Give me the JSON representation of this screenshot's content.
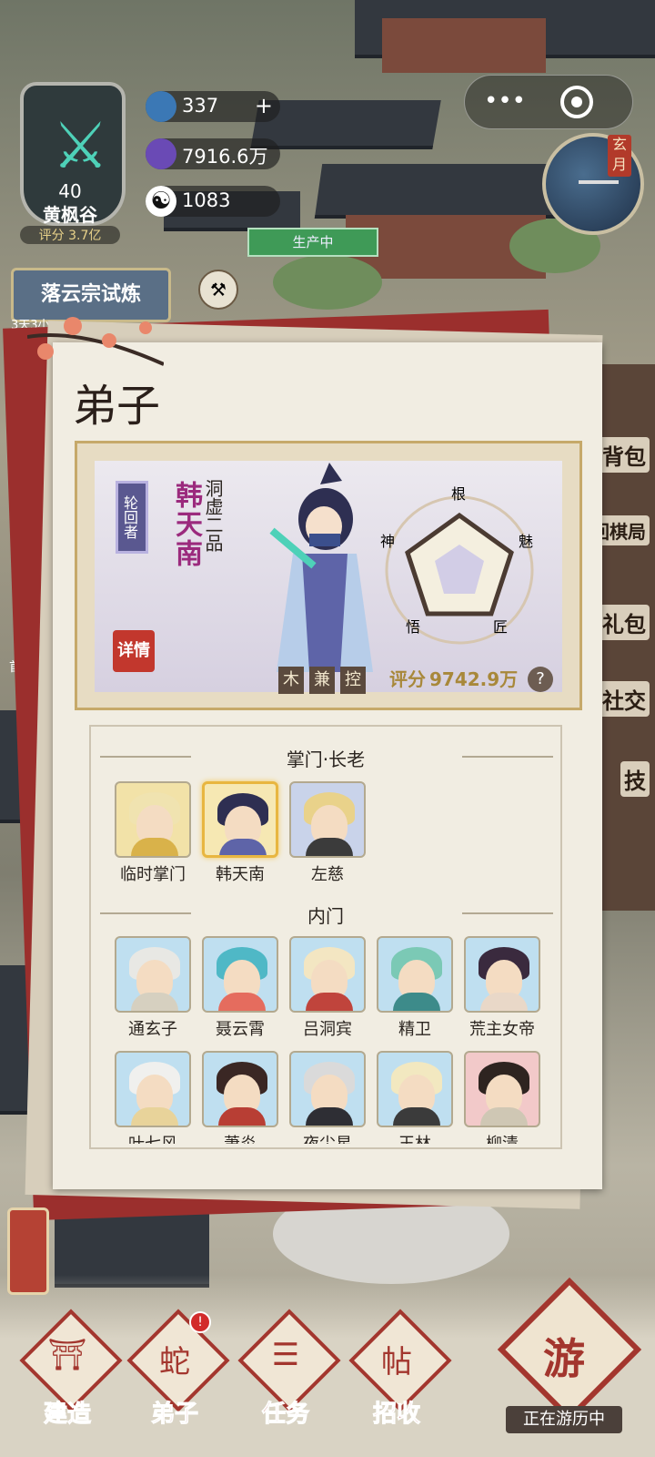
{
  "sect": {
    "level": "40",
    "name": "黄枫谷",
    "score": "评分 3.7亿",
    "emblem_icon": "sword-emblem-icon"
  },
  "resources": [
    {
      "icon": "spirit-stone-icon",
      "value": "337",
      "has_plus": true,
      "color": "#3b78b5"
    },
    {
      "icon": "crystal-icon",
      "value": "7916.6万",
      "has_plus": false,
      "color": "#6a4ab5"
    },
    {
      "icon": "yinyang-icon",
      "value": "1083",
      "has_plus": false,
      "color": "#1a1a1a"
    }
  ],
  "producing_label": "生产中",
  "capsule": {
    "more": "•••"
  },
  "clock_label": "玄月",
  "event": {
    "title": "落云宗试炼",
    "time": "3天3小",
    "tool_icon": "hammer-icon"
  },
  "side_menu": [
    "背包",
    "回棋局",
    "礼包",
    "社交",
    "技"
  ],
  "left_edge_text": "首次",
  "panel": {
    "title": "弟子",
    "hero": {
      "tag": "轮回者",
      "name": "韩天南",
      "rank": "洞虚二品",
      "detail_label": "详情",
      "elements": [
        "木",
        "兼",
        "控"
      ],
      "score_label": "评分",
      "score": "9742.9万",
      "help": "?",
      "radar": {
        "labels": [
          "根",
          "魅",
          "匠",
          "悟",
          "神"
        ]
      }
    },
    "sections": [
      {
        "title": "掌门·长老",
        "members": [
          {
            "name": "临时掌门",
            "bg": "#f2e2a8",
            "hair": "#f0e3b0",
            "body": "#d9b24a",
            "selected": false
          },
          {
            "name": "韩天南",
            "bg": "#f6e8b3",
            "hair": "#2e2f52",
            "body": "#5e64a8",
            "selected": true
          },
          {
            "name": "左慈",
            "bg": "#c9d3ea",
            "hair": "#e9d28a",
            "body": "#3b3b3b",
            "selected": false
          }
        ]
      },
      {
        "title": "内门",
        "members": [
          {
            "name": "通玄子",
            "bg": "#bfdff0",
            "hair": "#e8e8e4",
            "body": "#d6d0c0",
            "selected": false
          },
          {
            "name": "聂云霄",
            "bg": "#bfdff0",
            "hair": "#4fb8c6",
            "body": "#e56c5e",
            "selected": false
          },
          {
            "name": "吕洞宾",
            "bg": "#bfdff0",
            "hair": "#f3e6c2",
            "body": "#c0443c",
            "selected": false
          },
          {
            "name": "精卫",
            "bg": "#bfdff0",
            "hair": "#7bc9b5",
            "body": "#3d8b8a",
            "selected": false
          },
          {
            "name": "荒主女帝",
            "bg": "#bfdff0",
            "hair": "#3a2a3e",
            "body": "#e9d8c8",
            "selected": false
          },
          {
            "name": "叶七风",
            "bg": "#bfdff0",
            "hair": "#f0f0ee",
            "body": "#e8d39a",
            "selected": false
          },
          {
            "name": "萧炎",
            "bg": "#bfdff0",
            "hair": "#3a2724",
            "body": "#b83e34",
            "selected": false
          },
          {
            "name": "夜尘星",
            "bg": "#bfdff0",
            "hair": "#dadada",
            "body": "#2e2e34",
            "selected": false
          },
          {
            "name": "王林",
            "bg": "#bfdff0",
            "hair": "#f2e8c0",
            "body": "#3b3b3b",
            "selected": false
          },
          {
            "name": "柳清",
            "bg": "#f2c9c9",
            "hair": "#2e2420",
            "body": "#cfc7b4",
            "selected": false
          }
        ]
      }
    ]
  },
  "bottom_nav": [
    {
      "label": "建造",
      "glyph": "⛩",
      "icon": "build-icon",
      "badge": false
    },
    {
      "label": "弟子",
      "glyph": "蛇",
      "icon": "disciples-icon",
      "badge": true
    },
    {
      "label": "任务",
      "glyph": "☰",
      "icon": "tasks-icon",
      "badge": false
    },
    {
      "label": "招收",
      "glyph": "帖",
      "icon": "recruit-icon",
      "badge": false
    }
  ],
  "travel": {
    "label": "正在游历中",
    "glyph": "游",
    "icon": "travel-icon"
  }
}
